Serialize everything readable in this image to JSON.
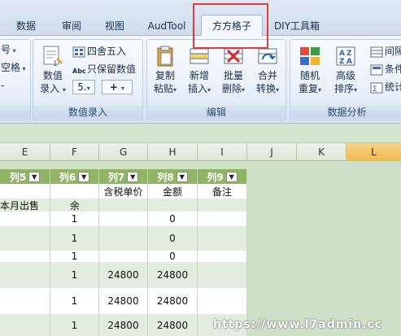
{
  "tabs": [
    {
      "label": "数据",
      "active": false
    },
    {
      "label": "审阅",
      "active": false
    },
    {
      "label": "视图",
      "active": false
    },
    {
      "label": "AudTool",
      "active": false
    },
    {
      "label": "方方格子",
      "active": true
    },
    {
      "label": "DIY工具箱",
      "active": false
    }
  ],
  "ribbon": {
    "left_partial": {
      "row1": "号",
      "row2": "空格",
      "row3": "-"
    },
    "numeric_group": {
      "label": "数值录入",
      "big_button": "数值\n录入",
      "round_label": "四舍五入",
      "keep_numeric_label": "只保留数值",
      "small_buttons": [
        "5.",
        "+"
      ]
    },
    "edit_group": {
      "label": "编辑",
      "buttons": [
        {
          "top": "复制",
          "bottom": "粘贴"
        },
        {
          "top": "新增",
          "bottom": "插入"
        },
        {
          "top": "批量",
          "bottom": "删除"
        },
        {
          "top": "合并",
          "bottom": "转换"
        }
      ]
    },
    "analysis_group": {
      "label": "数据分析",
      "buttons": [
        {
          "top": "随机",
          "bottom": "重复"
        },
        {
          "top": "高级",
          "bottom": "排序"
        }
      ],
      "right_items": [
        "间隔",
        "条件",
        "统计"
      ]
    }
  },
  "columns": [
    "E",
    "F",
    "G",
    "H",
    "I",
    "J",
    "K",
    "L"
  ],
  "selected_column": "L",
  "filters": [
    "列5",
    "列6",
    "列7",
    "列8",
    "列9"
  ],
  "header_row": {
    "e": "本月出售",
    "f": "余",
    "g": "含税单价",
    "h": "金额",
    "i": "备注"
  },
  "rows": [
    {
      "f": "1",
      "g": "",
      "h": "0"
    },
    {
      "f": "1",
      "g": "",
      "h": "0"
    },
    {
      "f": "1",
      "g": "",
      "h": "0"
    },
    {
      "f": "1",
      "g": "24800",
      "h": "24800"
    },
    {
      "f": "1",
      "g": "24800",
      "h": "24800"
    },
    {
      "f": "1",
      "g": "24800",
      "h": "24800"
    }
  ],
  "watermark": "https://www.l7admin.cc",
  "colors": {
    "accent_red": "#e23b3b",
    "selected_col": "#f0b94e",
    "filter_green": "#8fb564"
  }
}
